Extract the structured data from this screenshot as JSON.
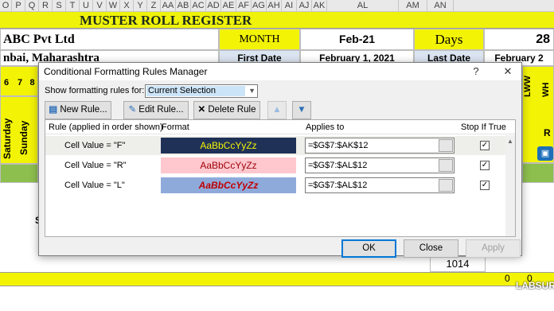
{
  "colors": {
    "accent": "#0078d7",
    "sheet_yellow": "#f3f306",
    "sheet_green": "#8dbf4f",
    "fmt_f_bg": "#1f3156",
    "fmt_f_fg": "#f3f306",
    "fmt_r_bg": "#ffc7ce",
    "fmt_r_fg": "#9c0006",
    "fmt_l_bg": "#8eaadb",
    "fmt_l_fg": "#c00000"
  },
  "spreadsheet": {
    "column_headers": [
      "O",
      "P",
      "Q",
      "R",
      "S",
      "T",
      "U",
      "V",
      "W",
      "X",
      "Y",
      "Z",
      "AA",
      "AB",
      "AC",
      "AD",
      "AE",
      "AF",
      "AG",
      "AH",
      "AI",
      "AJ",
      "AK",
      "AL",
      "AM",
      "AN"
    ],
    "title": "MUSTER ROLL REGISTER",
    "company": "ABC Pvt Ltd",
    "location": "nbai, Maharashtra",
    "month_label": "MONTH",
    "month_value": "Feb-21",
    "days_label": "Days",
    "days_value": "28",
    "first_date_label": "First Date",
    "first_date_value": "February 1, 2021",
    "last_date_label": "Last Date",
    "last_date_value": "February 2",
    "day_numbers": [
      "6",
      "7",
      "8"
    ],
    "weekday_labels": [
      "Saturday",
      "Sunday"
    ],
    "right_vertical_labels": [
      "LWW",
      "WH"
    ],
    "right_letter": "R",
    "left_letter": "S",
    "total_value": "1014",
    "bottom_zero_1": "0",
    "bottom_zero_2": "0",
    "watermark": "LABSUR"
  },
  "dialog": {
    "title": "Conditional Formatting Rules Manager",
    "help": "?",
    "close": "✕",
    "show_rules_label": "Show formatting rules for:",
    "show_rules_value": "Current Selection",
    "new_rule": "New Rule...",
    "edit_rule": "Edit Rule...",
    "delete_rule": "Delete Rule",
    "columns": {
      "rule": "Rule (applied in order shown)",
      "format": "Format",
      "applies_to": "Applies to",
      "stop_if_true": "Stop If True"
    },
    "rules": [
      {
        "rule": "Cell Value = \"F\"",
        "format_preview": "AaBbCcYyZz",
        "applies_to": "=$G$7:$AK$12",
        "stop_if_true": true
      },
      {
        "rule": "Cell Value = \"R\"",
        "format_preview": "AaBbCcYyZz",
        "applies_to": "=$G$7:$AL$12",
        "stop_if_true": true
      },
      {
        "rule": "Cell Value = \"L\"",
        "format_preview": "AaBbCcYyZz",
        "applies_to": "=$G$7:$AL$12",
        "stop_if_true": true
      }
    ],
    "ok": "OK",
    "close_button": "Close",
    "apply": "Apply"
  }
}
